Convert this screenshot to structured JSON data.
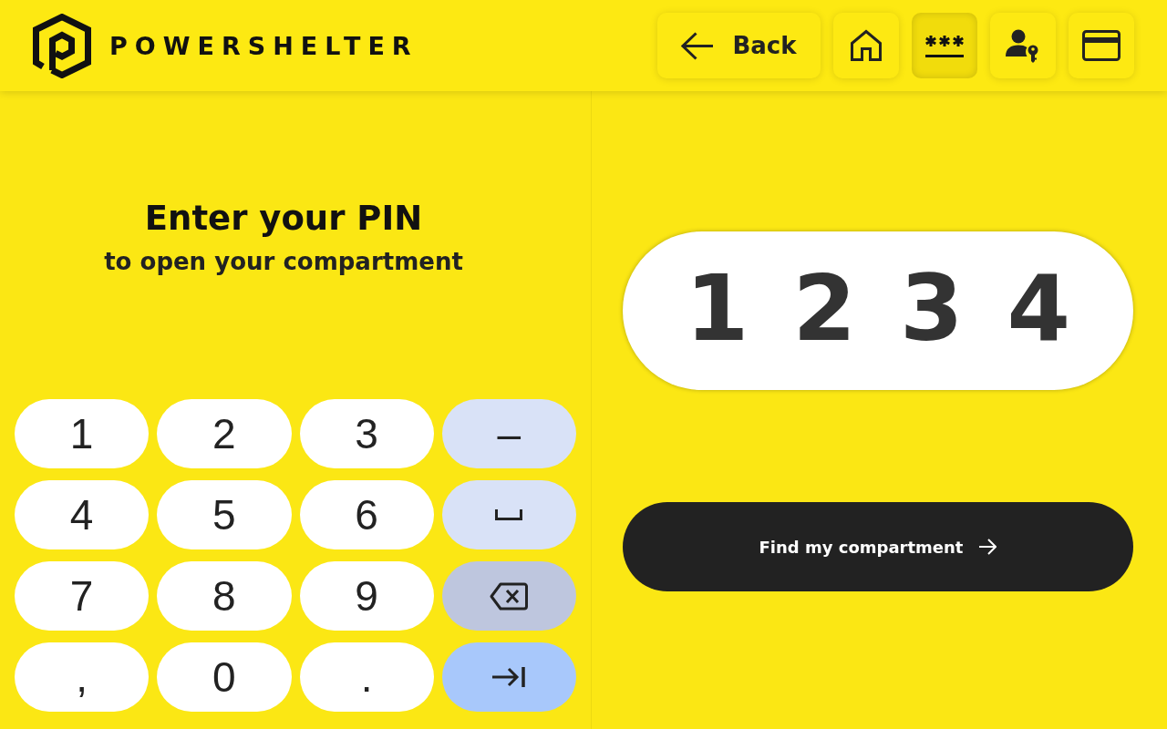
{
  "header": {
    "logo_text": "POWERSHELTER",
    "nav": [
      {
        "kind": "back",
        "label": "Back",
        "selected": false
      },
      {
        "kind": "home",
        "selected": false
      },
      {
        "kind": "pin",
        "selected": true
      },
      {
        "kind": "user_key",
        "selected": false
      },
      {
        "kind": "card",
        "selected": false
      }
    ]
  },
  "prompt": {
    "title": "Enter your PIN",
    "subtitle": "to open your compartment"
  },
  "keypad": {
    "keys": [
      {
        "kind": "char",
        "label": "1"
      },
      {
        "kind": "char",
        "label": "2"
      },
      {
        "kind": "char",
        "label": "3"
      },
      {
        "kind": "function",
        "label": "–"
      },
      {
        "kind": "char",
        "label": "4"
      },
      {
        "kind": "char",
        "label": "5"
      },
      {
        "kind": "char",
        "label": "6"
      },
      {
        "kind": "space"
      },
      {
        "kind": "char",
        "label": "7"
      },
      {
        "kind": "char",
        "label": "8"
      },
      {
        "kind": "char",
        "label": "9"
      },
      {
        "kind": "backspace"
      },
      {
        "kind": "char",
        "label": ","
      },
      {
        "kind": "char",
        "label": "0"
      },
      {
        "kind": "char",
        "label": "."
      },
      {
        "kind": "tab"
      }
    ]
  },
  "pin_field": {
    "value": "1234"
  },
  "submit_button": {
    "label": "Find my compartment"
  }
}
